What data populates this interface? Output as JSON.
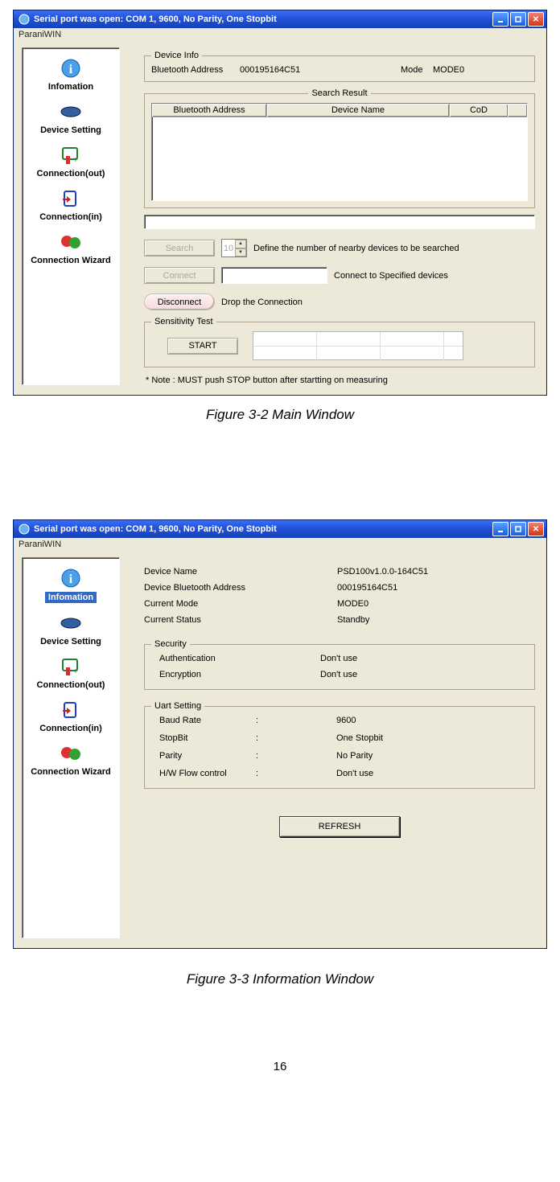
{
  "w1": {
    "title": "Serial port was open: COM 1, 9600, No Parity, One Stopbit",
    "menu": "ParaniWIN",
    "sidebar": [
      "Infomation",
      "Device Setting",
      "Connection(out)",
      "Connection(in)",
      "Connection Wizard"
    ],
    "devinfo": {
      "legend": "Device Info",
      "addr_label": "Bluetooth Address",
      "addr_value": "000195164C51",
      "mode_label": "Mode",
      "mode_value": "MODE0"
    },
    "search": {
      "legend": "Search Result",
      "cols": [
        "Bluetooth Address",
        "Device Name",
        "CoD"
      ]
    },
    "controls": {
      "search_btn": "Search",
      "spinner": "10",
      "search_note": "Define the number of nearby devices to be searched",
      "connect_btn": "Connect",
      "connect_note": "Connect to Specified devices",
      "disconnect_btn": "Disconnect",
      "disconnect_note": "Drop the Connection"
    },
    "sens": {
      "legend": "Sensitivity Test",
      "start_btn": "START"
    },
    "note": "* Note : MUST push STOP button after startting on measuring"
  },
  "fig1": "Figure 3-2 Main Window",
  "w2": {
    "title": "Serial port was open: COM 1, 9600, No Parity, One Stopbit",
    "menu": "ParaniWIN",
    "sidebar": [
      "Infomation",
      "Device Setting",
      "Connection(out)",
      "Connection(in)",
      "Connection Wizard"
    ],
    "info": {
      "devname_k": "Device Name",
      "devname_v": "PSD100v1.0.0-164C51",
      "bt_k": "Device Bluetooth Address",
      "bt_v": "000195164C51",
      "mode_k": "Current Mode",
      "mode_v": "MODE0",
      "status_k": "Current Status",
      "status_v": "Standby"
    },
    "security": {
      "legend": "Security",
      "auth_k": "Authentication",
      "auth_v": "Don't use",
      "enc_k": "Encryption",
      "enc_v": "Don't use"
    },
    "uart": {
      "legend": "Uart Setting",
      "baud_k": "Baud Rate",
      "baud_v": "9600",
      "stop_k": "StopBit",
      "stop_v": "One Stopbit",
      "parity_k": "Parity",
      "parity_v": "No Parity",
      "flow_k": "H/W Flow control",
      "flow_v": "Don't use",
      "colon": ":"
    },
    "refresh": "REFRESH"
  },
  "fig2": "Figure 3-3 Information Window",
  "page_num": "16"
}
